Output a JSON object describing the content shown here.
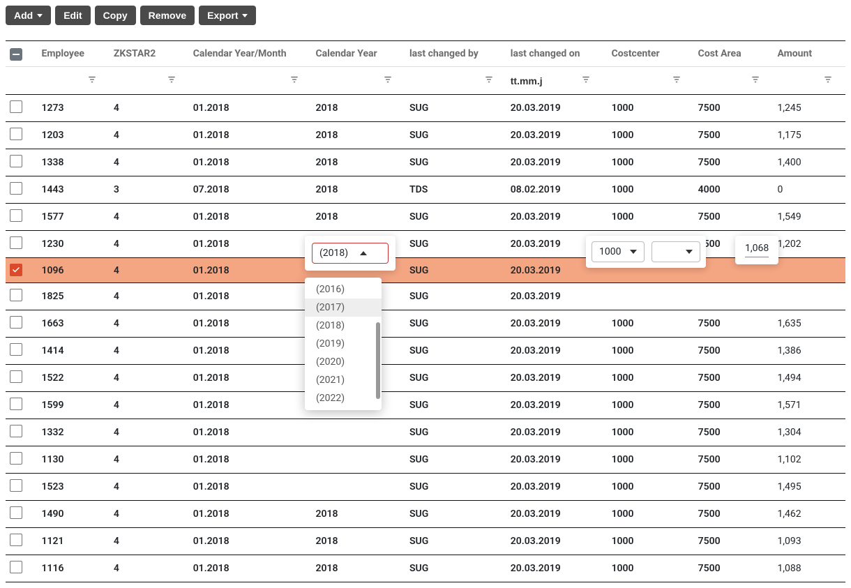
{
  "toolbar": {
    "add": "Add",
    "edit": "Edit",
    "copy": "Copy",
    "remove": "Remove",
    "export": "Export"
  },
  "columns": {
    "employee": "Employee",
    "zkstar2": "ZKSTAR2",
    "cal_year_month": "Calendar Year/Month",
    "cal_year": "Calendar Year",
    "last_changed_by": "last changed by",
    "last_changed_on": "last changed on",
    "costcenter": "Costcenter",
    "cost_area": "Cost Area",
    "amount": "Amount"
  },
  "filter": {
    "last_changed_on_placeholder": "tt.mm.j"
  },
  "rows": [
    {
      "checked": false,
      "employee": "1273",
      "zkstar2": "4",
      "cal_year_month": "01.2018",
      "cal_year": "2018",
      "last_changed_by": "SUG",
      "last_changed_on": "20.03.2019",
      "costcenter": "1000",
      "cost_area": "7500",
      "amount": "1,245"
    },
    {
      "checked": false,
      "employee": "1203",
      "zkstar2": "4",
      "cal_year_month": "01.2018",
      "cal_year": "2018",
      "last_changed_by": "SUG",
      "last_changed_on": "20.03.2019",
      "costcenter": "1000",
      "cost_area": "7500",
      "amount": "1,175"
    },
    {
      "checked": false,
      "employee": "1338",
      "zkstar2": "4",
      "cal_year_month": "01.2018",
      "cal_year": "2018",
      "last_changed_by": "SUG",
      "last_changed_on": "20.03.2019",
      "costcenter": "1000",
      "cost_area": "7500",
      "amount": "1,400"
    },
    {
      "checked": false,
      "employee": "1443",
      "zkstar2": "3",
      "cal_year_month": "07.2018",
      "cal_year": "2018",
      "last_changed_by": "TDS",
      "last_changed_on": "08.02.2019",
      "costcenter": "1000",
      "cost_area": "4000",
      "amount": "0"
    },
    {
      "checked": false,
      "employee": "1577",
      "zkstar2": "4",
      "cal_year_month": "01.2018",
      "cal_year": "2018",
      "last_changed_by": "SUG",
      "last_changed_on": "20.03.2019",
      "costcenter": "1000",
      "cost_area": "7500",
      "amount": "1,549"
    },
    {
      "checked": false,
      "employee": "1230",
      "zkstar2": "4",
      "cal_year_month": "01.2018",
      "cal_year": "2018",
      "last_changed_by": "SUG",
      "last_changed_on": "20.03.2019",
      "costcenter": "1000",
      "cost_area": "7500",
      "amount": "1,202"
    },
    {
      "checked": true,
      "employee": "1096",
      "zkstar2": "4",
      "cal_year_month": "01.2018",
      "cal_year": "",
      "last_changed_by": "SUG",
      "last_changed_on": "20.03.2019",
      "costcenter": "",
      "cost_area": "",
      "amount": ""
    },
    {
      "checked": false,
      "employee": "1825",
      "zkstar2": "4",
      "cal_year_month": "01.2018",
      "cal_year": "",
      "last_changed_by": "SUG",
      "last_changed_on": "20.03.2019",
      "costcenter": "",
      "cost_area": "",
      "amount": ""
    },
    {
      "checked": false,
      "employee": "1663",
      "zkstar2": "4",
      "cal_year_month": "01.2018",
      "cal_year": "",
      "last_changed_by": "SUG",
      "last_changed_on": "20.03.2019",
      "costcenter": "1000",
      "cost_area": "7500",
      "amount": "1,635"
    },
    {
      "checked": false,
      "employee": "1414",
      "zkstar2": "4",
      "cal_year_month": "01.2018",
      "cal_year": "",
      "last_changed_by": "SUG",
      "last_changed_on": "20.03.2019",
      "costcenter": "1000",
      "cost_area": "7500",
      "amount": "1,386"
    },
    {
      "checked": false,
      "employee": "1522",
      "zkstar2": "4",
      "cal_year_month": "01.2018",
      "cal_year": "",
      "last_changed_by": "SUG",
      "last_changed_on": "20.03.2019",
      "costcenter": "1000",
      "cost_area": "7500",
      "amount": "1,494"
    },
    {
      "checked": false,
      "employee": "1599",
      "zkstar2": "4",
      "cal_year_month": "01.2018",
      "cal_year": "",
      "last_changed_by": "SUG",
      "last_changed_on": "20.03.2019",
      "costcenter": "1000",
      "cost_area": "7500",
      "amount": "1,571"
    },
    {
      "checked": false,
      "employee": "1332",
      "zkstar2": "4",
      "cal_year_month": "01.2018",
      "cal_year": "",
      "last_changed_by": "SUG",
      "last_changed_on": "20.03.2019",
      "costcenter": "1000",
      "cost_area": "7500",
      "amount": "1,304"
    },
    {
      "checked": false,
      "employee": "1130",
      "zkstar2": "4",
      "cal_year_month": "01.2018",
      "cal_year": "",
      "last_changed_by": "SUG",
      "last_changed_on": "20.03.2019",
      "costcenter": "1000",
      "cost_area": "7500",
      "amount": "1,102"
    },
    {
      "checked": false,
      "employee": "1523",
      "zkstar2": "4",
      "cal_year_month": "01.2018",
      "cal_year": "",
      "last_changed_by": "SUG",
      "last_changed_on": "20.03.2019",
      "costcenter": "1000",
      "cost_area": "7500",
      "amount": "1,495"
    },
    {
      "checked": false,
      "employee": "1490",
      "zkstar2": "4",
      "cal_year_month": "01.2018",
      "cal_year": "2018",
      "last_changed_by": "SUG",
      "last_changed_on": "20.03.2019",
      "costcenter": "1000",
      "cost_area": "7500",
      "amount": "1,462"
    },
    {
      "checked": false,
      "employee": "1121",
      "zkstar2": "4",
      "cal_year_month": "01.2018",
      "cal_year": "2018",
      "last_changed_by": "SUG",
      "last_changed_on": "20.03.2019",
      "costcenter": "1000",
      "cost_area": "7500",
      "amount": "1,093"
    },
    {
      "checked": false,
      "employee": "1116",
      "zkstar2": "4",
      "cal_year_month": "01.2018",
      "cal_year": "2018",
      "last_changed_by": "SUG",
      "last_changed_on": "20.03.2019",
      "costcenter": "1000",
      "cost_area": "7500",
      "amount": "1,088"
    }
  ],
  "year_editor": {
    "selected": "(2018)",
    "options": [
      "(2016)",
      "(2017)",
      "(2018)",
      "(2019)",
      "(2020)",
      "(2021)",
      "(2022)"
    ],
    "hover_index": 1
  },
  "costcenter_editor": {
    "value": "1000"
  },
  "costarea_editor": {
    "value": ""
  },
  "amount_editor": {
    "value": "1,068"
  }
}
